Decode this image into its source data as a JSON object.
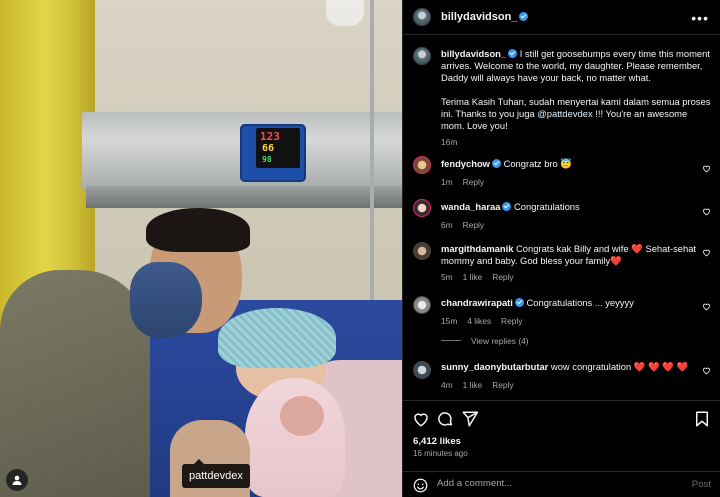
{
  "post": {
    "author": "billydavidson_",
    "caption_text": "I still get goosebumps every time this moment arrives. Welcome to the world, my daughter. Please remember, Daddy will always have your back, no matter what.",
    "caption_text2a": "Terima Kasih Tuhan, sudah menyertai kami dalam semua proses ini. Thanks to you juga ",
    "caption_mention": "@pattdevdex",
    "caption_text2b": " !!! You're an awesome mom. Love you!",
    "caption_time": "16m",
    "likes": "6,412 likes",
    "posted_ago": "16 minutes ago",
    "photo_tag": "pattdevdex"
  },
  "monitor": {
    "line1": "123",
    "line2": "66",
    "line3": "98"
  },
  "comments": [
    {
      "user": "fendychow",
      "verified": true,
      "text": "Congratz bro 😇",
      "time": "1m",
      "likes": "",
      "reply": "Reply"
    },
    {
      "user": "wanda_haraa",
      "verified": true,
      "text": "Congratulations",
      "time": "6m",
      "likes": "",
      "reply": "Reply"
    },
    {
      "user": "margithdamanik",
      "verified": false,
      "text": "Congrats kak Billy and wife ❤️ Sehat-sehat mommy and baby. God bless your family❤️",
      "time": "5m",
      "likes": "1 like",
      "reply": "Reply"
    },
    {
      "user": "chandrawirapati",
      "verified": true,
      "text": "Congratulations ... yeyyyy",
      "time": "15m",
      "likes": "4 likes",
      "reply": "Reply",
      "view_replies": "View replies (4)"
    },
    {
      "user": "sunny_daonybutarbutar",
      "verified": false,
      "text": "wow congratulation ❤️ ❤️ ❤️ ❤️",
      "time": "4m",
      "likes": "1 like",
      "reply": "Reply"
    }
  ],
  "composer": {
    "placeholder": "Add a comment...",
    "post_label": "Post"
  },
  "icons": [
    "heart-icon",
    "comment-icon",
    "share-icon",
    "bookmark-icon",
    "emoji-icon",
    "more-icon",
    "user-tag-icon"
  ],
  "colors": {
    "verified": "#3897f0",
    "background": "#000000",
    "muted": "#a8a8a8"
  }
}
